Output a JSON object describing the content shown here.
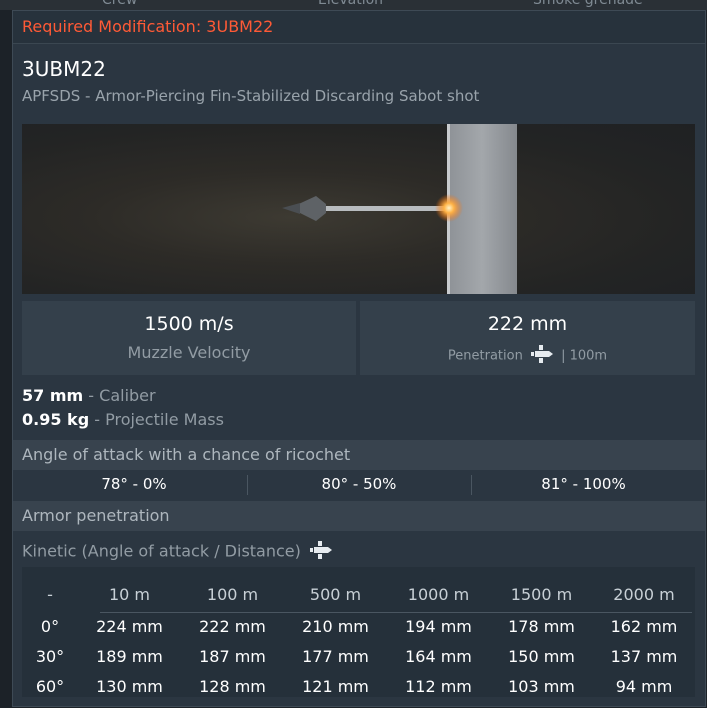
{
  "background": {
    "items": [
      "Crew",
      "Elevation",
      "Smoke grenade"
    ]
  },
  "tooltip": {
    "required_modification": "Required Modification: 3UBM22",
    "title": "3UBM22",
    "subtitle": "APFSDS - Armor-Piercing Fin-Stabilized Discarding Sabot shot",
    "muzzle_velocity": {
      "value": "1500 m/s",
      "label": "Muzzle Velocity"
    },
    "penetration": {
      "value": "222 mm",
      "label": "Penetration",
      "suffix": "| 100m"
    },
    "properties": [
      {
        "value": "57 mm",
        "label": "- Caliber"
      },
      {
        "value": "0.95 kg",
        "label": "- Projectile Mass"
      }
    ],
    "ricochet": {
      "header": "Angle of attack with a chance of ricochet",
      "values": [
        "78° - 0%",
        "80° - 50%",
        "81° - 100%"
      ]
    },
    "armor": {
      "header": "Armor penetration",
      "kinetic_label": "Kinetic (Angle of attack / Distance)",
      "columns": [
        "-",
        "10 m",
        "100 m",
        "500 m",
        "1000 m",
        "1500 m",
        "2000 m"
      ],
      "rows": [
        {
          "angle": "0°",
          "values": [
            "224 mm",
            "222 mm",
            "210 mm",
            "194 mm",
            "178 mm",
            "162 mm"
          ]
        },
        {
          "angle": "30°",
          "values": [
            "189 mm",
            "187 mm",
            "177 mm",
            "164 mm",
            "150 mm",
            "137 mm"
          ]
        },
        {
          "angle": "60°",
          "values": [
            "130 mm",
            "128 mm",
            "121 mm",
            "112 mm",
            "103 mm",
            "94 mm"
          ]
        }
      ]
    }
  },
  "colors": {
    "accent_required": "#ff5a36",
    "panel": "#2b3641",
    "stat_box": "#34404b"
  }
}
